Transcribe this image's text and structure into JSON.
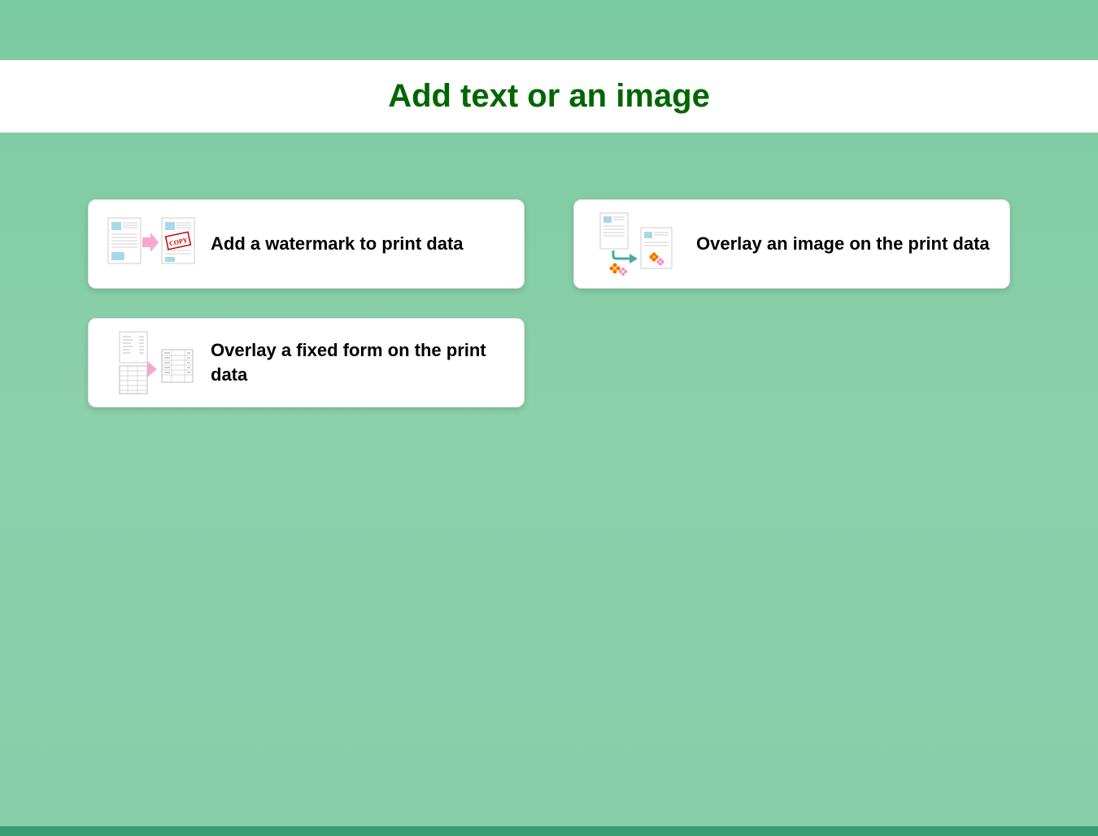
{
  "header": {
    "title": "Add text or an image"
  },
  "options": {
    "watermark": {
      "label": "Add a watermark to print data",
      "icon": "watermark-icon"
    },
    "overlay_image": {
      "label": "Overlay an image on the print data",
      "icon": "overlay-image-icon"
    },
    "overlay_form": {
      "label": "Overlay a fixed form on the print data",
      "icon": "overlay-form-icon"
    }
  },
  "colors": {
    "background": "#7acaa0",
    "title": "#006600",
    "card_bg": "#ffffff",
    "text": "#000000"
  }
}
